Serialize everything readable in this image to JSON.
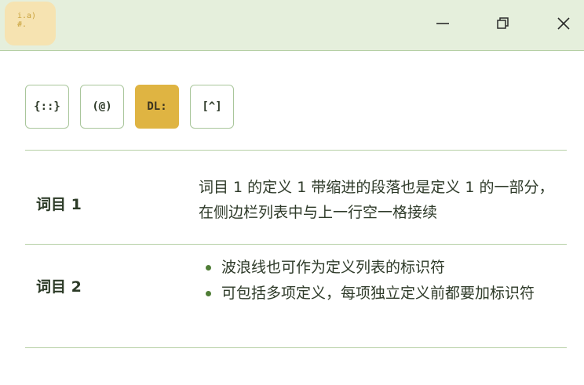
{
  "app_icon": {
    "line1": "i.a)",
    "line2": "#."
  },
  "window_controls": {
    "minimize": "minimize",
    "maximize": "maximize",
    "close": "close"
  },
  "toolbar": {
    "buttons": [
      {
        "label": "{::}",
        "active": false
      },
      {
        "label": "(@)",
        "active": false
      },
      {
        "label": "DL:",
        "active": true
      },
      {
        "label": "[^]",
        "active": false
      }
    ]
  },
  "definitions": [
    {
      "term": "词目 1",
      "definition": "词目 1 的定义 1 带缩进的段落也是定义 1 的一部分，在侧边栏列表中与上一行空一格接续"
    },
    {
      "term": "词目 2",
      "items": [
        "波浪线也可作为定义列表的标识符",
        "可包括多项定义，每项独立定义前都要加标识符"
      ]
    }
  ],
  "colors": {
    "titlebar": "#e5efdc",
    "accent": "#dfb442",
    "rule": "#b5cfa4",
    "bullet": "#4f7d36"
  }
}
